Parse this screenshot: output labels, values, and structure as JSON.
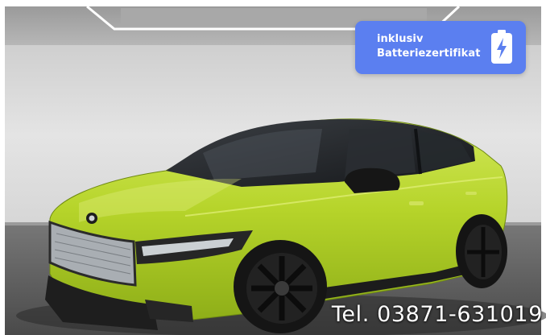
{
  "badge": {
    "line1": "inklusiv",
    "line2": "Batteriezertifikat",
    "icon": "battery-charging-icon",
    "color": "#5b7ff0"
  },
  "overlay": {
    "phone": "Tel. 03871-631019"
  },
  "colors": {
    "car_body": "#b6d42a",
    "wall": "#d9d9d9",
    "floor": "#5e5e5e"
  }
}
